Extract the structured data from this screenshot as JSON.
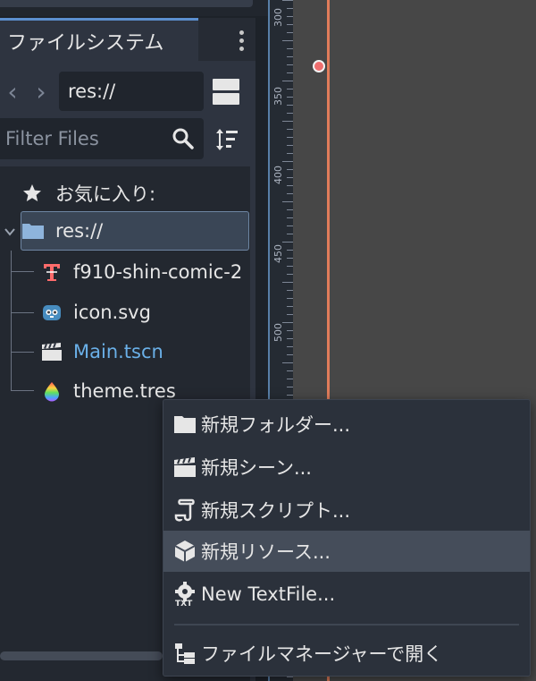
{
  "dock": {
    "tab_title": "ファイルシステム",
    "path": "res://",
    "filter_placeholder": "Filter Files"
  },
  "tree": {
    "favorites_label": "お気に入り:",
    "root_label": "res://",
    "files": [
      {
        "label": "f910-shin-comic-2",
        "icon": "font-file-icon"
      },
      {
        "label": "icon.svg",
        "icon": "godot-icon"
      },
      {
        "label": "Main.tscn",
        "icon": "scene-clapper-icon",
        "color": "#6ab0e8"
      },
      {
        "label": "theme.tres",
        "icon": "theme-drop-icon"
      }
    ]
  },
  "ruler": {
    "labels": [
      "300",
      "350",
      "400",
      "450",
      "500"
    ]
  },
  "context_menu": {
    "items": [
      {
        "label": "新規フォルダー...",
        "icon": "folder-icon"
      },
      {
        "label": "新規シーン...",
        "icon": "scene-clapper-icon"
      },
      {
        "label": "新規スクリプト...",
        "icon": "script-icon"
      },
      {
        "label": "新規リソース...",
        "icon": "resource-cube-icon",
        "hovered": true
      },
      {
        "label": "New TextFile...",
        "icon": "text-file-gear-icon"
      },
      {
        "label": "ファイルマネージャーで開く",
        "icon": "filesystem-tree-icon"
      }
    ]
  },
  "colors": {
    "accent": "#5c8fcf",
    "guide": "#e07c5a",
    "scene_file": "#6ab0e8"
  }
}
